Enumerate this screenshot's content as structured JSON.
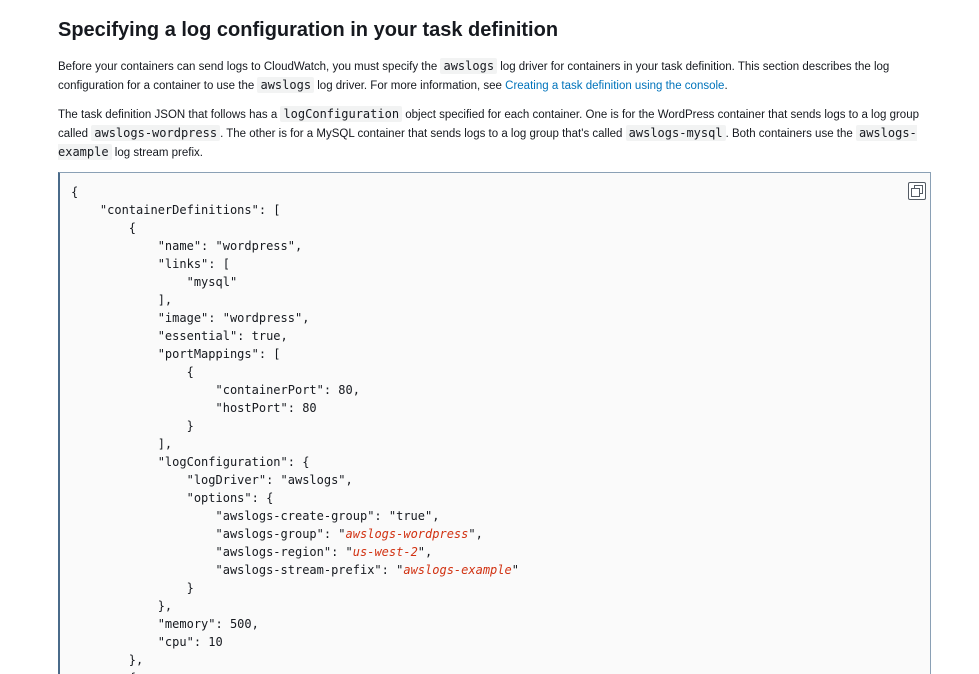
{
  "section": {
    "title": "Specifying a log configuration in your task definition"
  },
  "para1": {
    "t1": "Before your containers can send logs to CloudWatch, you must specify the ",
    "c1": "awslogs",
    "t2": " log driver for containers in your task definition. This section describes the log configuration for a container to use the ",
    "c2": "awslogs",
    "t3": " log driver. For more information, see ",
    "link": "Creating a task definition using the console",
    "t4": "."
  },
  "para2": {
    "t1": "The task definition JSON that follows has a ",
    "c1": "logConfiguration",
    "t2": " object specified for each container. One is for the WordPress container that sends logs to a log group called ",
    "c2": "awslogs-wordpress",
    "t3": ". The other is for a MySQL container that sends logs to a log group that's called ",
    "c3": "awslogs-mysql",
    "t4": ". Both containers use the ",
    "c4": "awslogs-example",
    "t5": " log stream prefix."
  },
  "code": {
    "copy_icon": "copy-icon",
    "lines": [
      [
        {
          "t": "{"
        }
      ],
      [
        {
          "t": "    \"containerDefinitions\": ["
        }
      ],
      [
        {
          "t": "        {"
        }
      ],
      [
        {
          "t": "            \"name\": \"wordpress\","
        }
      ],
      [
        {
          "t": "            \"links\": ["
        }
      ],
      [
        {
          "t": "                \"mysql\""
        }
      ],
      [
        {
          "t": "            ],"
        }
      ],
      [
        {
          "t": "            \"image\": \"wordpress\","
        }
      ],
      [
        {
          "t": "            \"essential\": true,"
        }
      ],
      [
        {
          "t": "            \"portMappings\": ["
        }
      ],
      [
        {
          "t": "                {"
        }
      ],
      [
        {
          "t": "                    \"containerPort\": 80,"
        }
      ],
      [
        {
          "t": "                    \"hostPort\": 80"
        }
      ],
      [
        {
          "t": "                }"
        }
      ],
      [
        {
          "t": "            ],"
        }
      ],
      [
        {
          "t": "            \"logConfiguration\": {"
        }
      ],
      [
        {
          "t": "                \"logDriver\": \"awslogs\","
        }
      ],
      [
        {
          "t": "                \"options\": {"
        }
      ],
      [
        {
          "t": "                    \"awslogs-create-group\": \"true\","
        }
      ],
      [
        {
          "t": "                    \"awslogs-group\": \""
        },
        {
          "t": "awslogs-wordpress",
          "red": true
        },
        {
          "t": "\","
        }
      ],
      [
        {
          "t": "                    \"awslogs-region\": \""
        },
        {
          "t": "us-west-2",
          "red": true
        },
        {
          "t": "\","
        }
      ],
      [
        {
          "t": "                    \"awslogs-stream-prefix\": \""
        },
        {
          "t": "awslogs-example",
          "red": true
        },
        {
          "t": "\""
        }
      ],
      [
        {
          "t": "                }"
        }
      ],
      [
        {
          "t": "            },"
        }
      ],
      [
        {
          "t": "            \"memory\": 500,"
        }
      ],
      [
        {
          "t": "            \"cpu\": 10"
        }
      ],
      [
        {
          "t": "        },"
        }
      ],
      [
        {
          "t": "        {"
        }
      ]
    ]
  }
}
